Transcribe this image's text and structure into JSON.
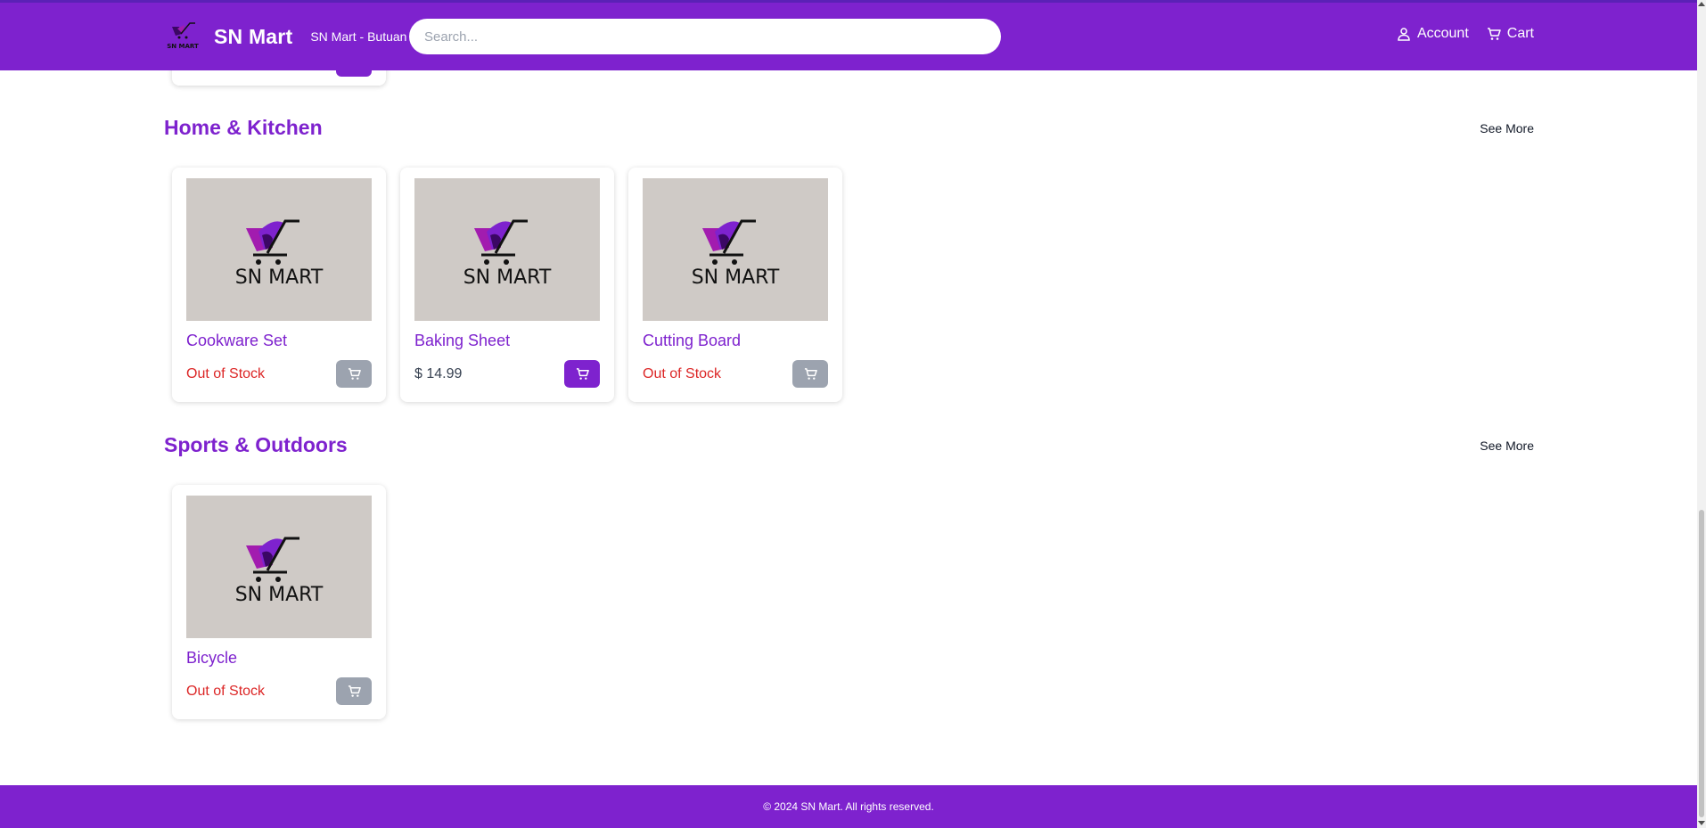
{
  "header": {
    "brand": "SN Mart",
    "branch": "SN Mart - Butuan",
    "search_placeholder": "Search...",
    "account_label": "Account",
    "cart_label": "Cart"
  },
  "logo": {
    "wordmark": "SN MART"
  },
  "sections": [
    {
      "title": "Home & Kitchen",
      "see_more": "See More",
      "products": [
        {
          "name": "Cookware Set",
          "status": "Out of Stock",
          "in_stock": false
        },
        {
          "name": "Baking Sheet",
          "price": "$ 14.99",
          "in_stock": true
        },
        {
          "name": "Cutting Board",
          "status": "Out of Stock",
          "in_stock": false
        }
      ]
    },
    {
      "title": "Sports & Outdoors",
      "see_more": "See More",
      "products": [
        {
          "name": "Bicycle",
          "status": "Out of Stock",
          "in_stock": false
        }
      ]
    }
  ],
  "footer": {
    "copyright": "© 2024 SN Mart. All rights reserved."
  },
  "colors": {
    "brand_purple": "#7e22ce",
    "out_of_stock_red": "#dc2626",
    "disabled_button": "#9ca3af",
    "image_placeholder_bg": "#cfcac6"
  },
  "icons": {
    "account": "user-icon",
    "cart": "cart-icon",
    "add_to_cart": "cart-icon"
  }
}
